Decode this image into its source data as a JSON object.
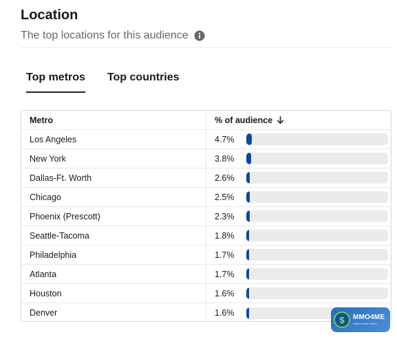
{
  "header": {
    "title": "Location",
    "subtitle": "The top locations for this audience"
  },
  "tabs": [
    {
      "label": "Top metros",
      "active": true
    },
    {
      "label": "Top countries",
      "active": false
    }
  ],
  "table": {
    "columns": {
      "metro": "Metro",
      "percent": "% of audience"
    },
    "sort": "descending",
    "bar_color": "#0a4a99",
    "bar_track_color": "#ebebeb",
    "rows": [
      {
        "metro": "Los Angeles",
        "percent": "4.7%",
        "value": 4.7
      },
      {
        "metro": "New York",
        "percent": "3.8%",
        "value": 3.8
      },
      {
        "metro": "Dallas-Ft. Worth",
        "percent": "2.6%",
        "value": 2.6
      },
      {
        "metro": "Chicago",
        "percent": "2.5%",
        "value": 2.5
      },
      {
        "metro": "Phoenix (Prescott)",
        "percent": "2.3%",
        "value": 2.3
      },
      {
        "metro": "Seattle-Tacoma",
        "percent": "1.8%",
        "value": 1.8
      },
      {
        "metro": "Philadelphia",
        "percent": "1.7%",
        "value": 1.7
      },
      {
        "metro": "Atlanta",
        "percent": "1.7%",
        "value": 1.7
      },
      {
        "metro": "Houston",
        "percent": "1.6%",
        "value": 1.6
      },
      {
        "metro": "Denver",
        "percent": "1.6%",
        "value": 1.6
      }
    ]
  },
  "watermark": {
    "brand": "MMO4ME",
    "tagline": "make money online"
  }
}
